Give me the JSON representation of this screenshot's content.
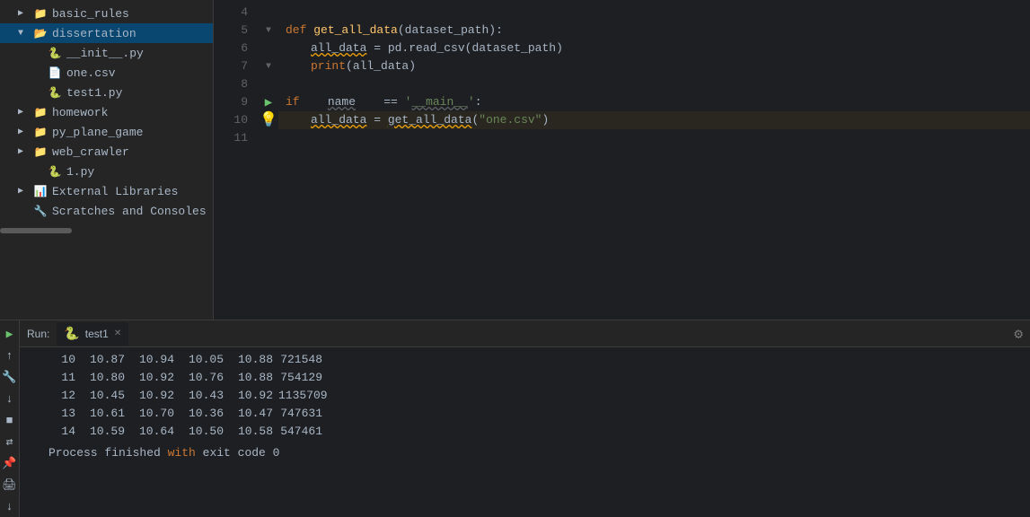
{
  "sidebar": {
    "items": [
      {
        "id": "basic_rules",
        "label": "basic_rules",
        "type": "folder",
        "indent": 1,
        "collapsed": true
      },
      {
        "id": "dissertation",
        "label": "dissertation",
        "type": "folder",
        "indent": 1,
        "collapsed": false,
        "selected": true
      },
      {
        "id": "__init__py",
        "label": "__init__.py",
        "type": "py",
        "indent": 2
      },
      {
        "id": "one_csv",
        "label": "one.csv",
        "type": "csv",
        "indent": 2
      },
      {
        "id": "test1py",
        "label": "test1.py",
        "type": "py",
        "indent": 2
      },
      {
        "id": "homework",
        "label": "homework",
        "type": "folder",
        "indent": 1,
        "collapsed": true
      },
      {
        "id": "py_plane_game",
        "label": "py_plane_game",
        "type": "folder",
        "indent": 1,
        "collapsed": true
      },
      {
        "id": "web_crawler",
        "label": "web_crawler",
        "type": "folder",
        "indent": 1,
        "collapsed": true
      },
      {
        "id": "1py",
        "label": "1.py",
        "type": "py",
        "indent": 2
      },
      {
        "id": "external_libraries",
        "label": "External Libraries",
        "type": "external",
        "indent": 1,
        "collapsed": true
      },
      {
        "id": "scratches",
        "label": "Scratches and Consoles",
        "type": "scratches",
        "indent": 1,
        "collapsed": true
      }
    ]
  },
  "editor": {
    "lines": [
      {
        "num": 4,
        "content": "",
        "gutter": ""
      },
      {
        "num": 5,
        "content": "def get_all_data(dataset_path):",
        "gutter": "fold"
      },
      {
        "num": 6,
        "content": "    all_data = pd.read_csv(dataset_path)",
        "gutter": ""
      },
      {
        "num": 7,
        "content": "    print(all_data)",
        "gutter": "fold"
      },
      {
        "num": 8,
        "content": "",
        "gutter": ""
      },
      {
        "num": 9,
        "content": "if    name    ==  '__main__':",
        "gutter": "debug-arrow"
      },
      {
        "num": 10,
        "content": "    all_data = get_all_data(\"one.csv\")",
        "gutter": "debug-dot"
      },
      {
        "num": 11,
        "content": "",
        "gutter": ""
      }
    ]
  },
  "run_panel": {
    "label": "Run:",
    "tab_name": "test1",
    "output": {
      "rows": [
        {
          "index": "10",
          "c1": "10.87",
          "c2": "10.94",
          "c3": "10.05",
          "c4": "10.88",
          "c5": "721548"
        },
        {
          "index": "11",
          "c1": "10.80",
          "c2": "10.92",
          "c3": "10.76",
          "c4": "10.88",
          "c5": "754129"
        },
        {
          "index": "12",
          "c1": "10.45",
          "c2": "10.92",
          "c3": "10.43",
          "c4": "10.92",
          "c5": "1135709"
        },
        {
          "index": "13",
          "c1": "10.61",
          "c2": "10.70",
          "c3": "10.36",
          "c4": "10.47",
          "c5": "747631"
        },
        {
          "index": "14",
          "c1": "10.59",
          "c2": "10.64",
          "c3": "10.50",
          "c4": "10.58",
          "c5": "547461"
        }
      ],
      "process_msg": "Process finished with exit code 0"
    }
  },
  "colors": {
    "background": "#1e1f22",
    "sidebar_bg": "#252526",
    "selected_bg": "#094771",
    "keyword": "#cc7832",
    "function": "#ffc66d",
    "string": "#6a8759",
    "accent_green": "#6bc46d"
  }
}
